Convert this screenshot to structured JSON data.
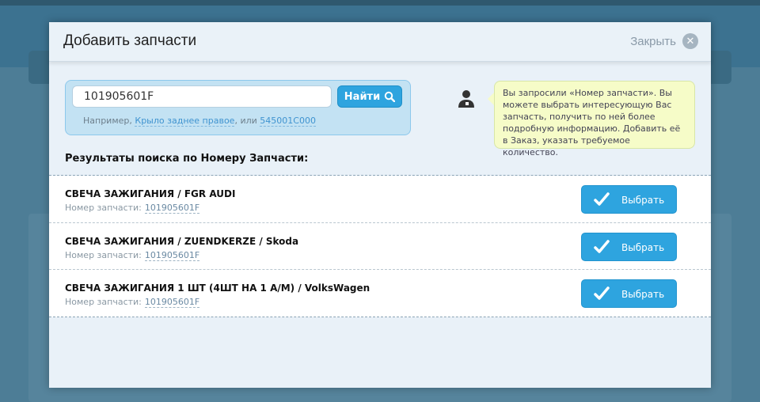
{
  "modal": {
    "title": "Добавить запчасти",
    "close_label": "Закрыть"
  },
  "search": {
    "value": "101905601F",
    "button_label": "Найти",
    "hint_prefix": "Например,",
    "hint_link1": "Крыло заднее правое",
    "hint_mid": ", или",
    "hint_link2": "545001C000"
  },
  "tooltip": "Вы запросили «Номер запчасти». Вы можете выбрать интересующую Вас запчасть, получить по ней более подробную информацию. Добавить её в Заказ, указать требуемое количество.",
  "results_title": "Результаты поиска по Номеру Запчасти:",
  "results": [
    {
      "name": "СВЕЧА ЗАЖИГАНИЯ / FGR AUDI",
      "number_label": "Номер запчасти:",
      "number": "101905601F",
      "button": "Выбрать"
    },
    {
      "name": "СВЕЧА ЗАЖИГАНИЯ / ZUENDKERZE / Skoda",
      "number_label": "Номер запчасти:",
      "number": "101905601F",
      "button": "Выбрать"
    },
    {
      "name": "СВЕЧА ЗАЖИГАНИЯ 1 ШТ (4ШТ НА 1 А/М) / VolksWagen",
      "number_label": "Номер запчасти:",
      "number": "101905601F",
      "button": "Выбрать"
    }
  ]
}
